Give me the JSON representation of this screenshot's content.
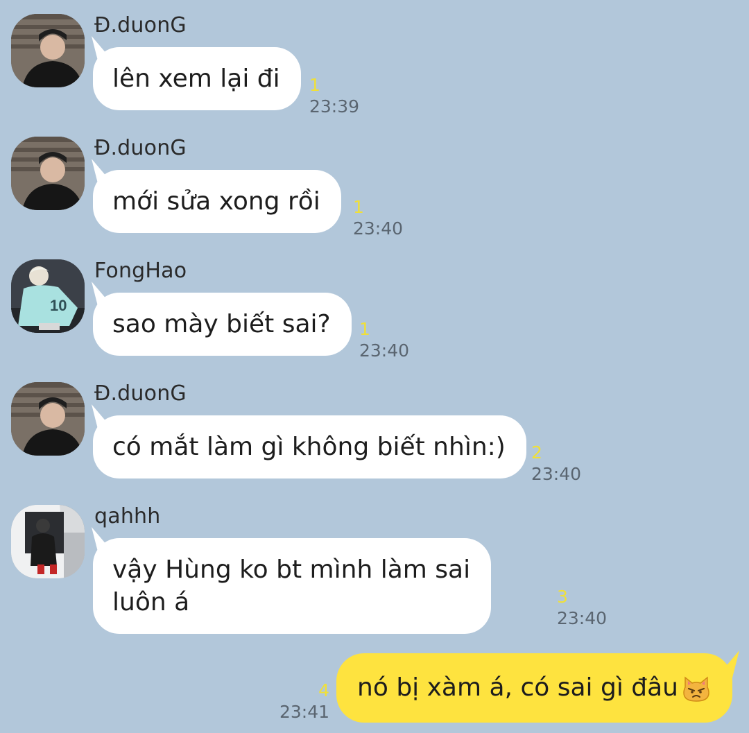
{
  "chat": {
    "messages": [
      {
        "sender": "Đ.duonG",
        "avatar": "dark-sweater-avatar",
        "lines": [
          "lên xem lại đi"
        ],
        "unread": "1",
        "time": "23:39"
      },
      {
        "sender": "Đ.duonG",
        "avatar": "dark-sweater-avatar",
        "lines": [
          "mới sửa xong rồi"
        ],
        "unread": "1",
        "time": "23:40"
      },
      {
        "sender": "FongHao",
        "avatar": "jersey-avatar",
        "lines": [
          "sao mày biết sai?"
        ],
        "unread": "1",
        "time": "23:40"
      },
      {
        "sender": "Đ.duonG",
        "avatar": "dark-sweater-avatar",
        "lines": [
          "có mắt làm gì không biết nhìn:)"
        ],
        "unread": "2",
        "time": "23:40"
      },
      {
        "sender": "qahhh",
        "avatar": "car-photo-avatar",
        "lines": [
          "vậy Hùng ko bt mình làm sai",
          "luôn á"
        ],
        "unread": "3",
        "time": "23:40"
      }
    ],
    "own_message": {
      "text": "nó bị xàm á, có sai gì đâu",
      "emoji": "pouting-cat-icon",
      "unread": "4",
      "time": "23:41"
    }
  },
  "colors": {
    "background": "#b2c7da",
    "incoming_bubble": "#ffffff",
    "outgoing_bubble": "#fee33f",
    "unread_count": "#f0e038",
    "timestamp": "#5a6570"
  }
}
